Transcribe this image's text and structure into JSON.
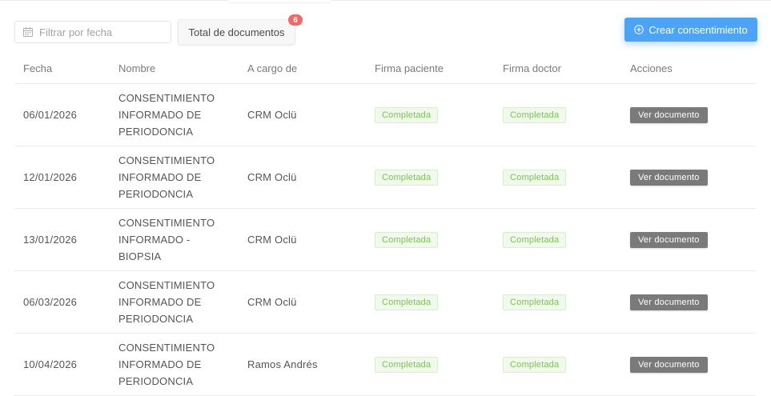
{
  "toolbar": {
    "date_filter_placeholder": "Filtrar por fecha",
    "total_label": "Total de documentos",
    "total_count": "6",
    "create_label": "Crear consentimiento",
    "accent_color": "#4da3f5",
    "badge_color": "#f06a6a"
  },
  "table": {
    "columns": [
      "Fecha",
      "Nombre",
      "A cargo de",
      "Firma paciente",
      "Firma doctor",
      "Acciones"
    ],
    "rows": [
      {
        "fecha": "06/01/2026",
        "nombre": "CONSENTIMIENTO INFORMADO DE PERIODONCIA",
        "cargo": "CRM Oclü",
        "firma_paciente": "Completada",
        "firma_doctor": "Completada",
        "accion": "Ver documento"
      },
      {
        "fecha": "12/01/2026",
        "nombre": "CONSENTIMIENTO INFORMADO DE PERIODONCIA",
        "cargo": "CRM Oclü",
        "firma_paciente": "Completada",
        "firma_doctor": "Completada",
        "accion": "Ver documento"
      },
      {
        "fecha": "13/01/2026",
        "nombre": "CONSENTIMIENTO INFORMADO - BIOPSIA",
        "cargo": "CRM Oclü",
        "firma_paciente": "Completada",
        "firma_doctor": "Completada",
        "accion": "Ver documento"
      },
      {
        "fecha": "06/03/2026",
        "nombre": "CONSENTIMIENTO INFORMADO DE PERIODONCIA",
        "cargo": "CRM Oclü",
        "firma_paciente": "Completada",
        "firma_doctor": "Completada",
        "accion": "Ver documento"
      },
      {
        "fecha": "10/04/2026",
        "nombre": "CONSENTIMIENTO INFORMADO DE PERIODONCIA",
        "cargo": "Ramos Andrés",
        "firma_paciente": "Completada",
        "firma_doctor": "Completada",
        "accion": "Ver documento"
      }
    ]
  },
  "icons": {
    "date_filter": "calendar-icon",
    "create": "plus-circle-icon"
  }
}
